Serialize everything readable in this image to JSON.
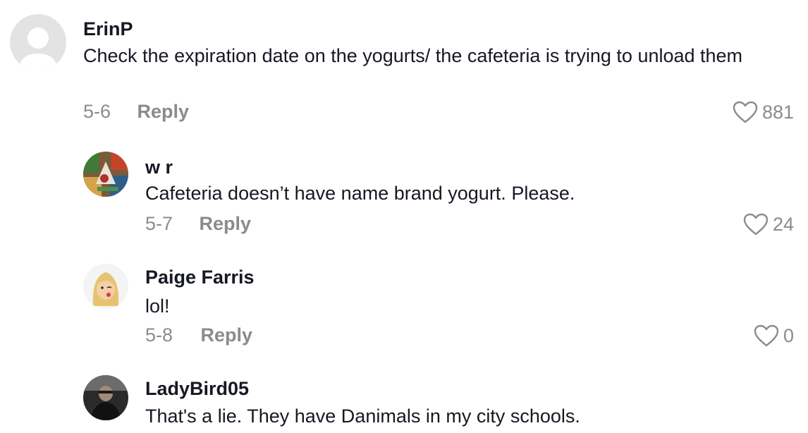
{
  "comments": [
    {
      "author": "ErinP",
      "text": "Check the expiration date on the yogurts/ the cafeteria is trying to unload them",
      "date": "5-6",
      "reply_label": "Reply",
      "likes": "881",
      "avatar": "default-avatar"
    },
    {
      "author": "w r",
      "text": "Cafeteria doesn’t have name brand yogurt. Please.",
      "date": "5-7",
      "reply_label": "Reply",
      "likes": "24",
      "avatar": "colorful-photo-avatar"
    },
    {
      "author": "Paige Farris",
      "text": "lol!",
      "date": "5-8",
      "reply_label": "Reply",
      "likes": "0",
      "avatar": "memoji-avatar"
    },
    {
      "author": "LadyBird05",
      "text": "That's a lie. They have Danimals in my city schools.",
      "avatar": "photo-avatar"
    }
  ],
  "colors": {
    "text": "#161823",
    "muted": "#8a8b91",
    "avatar_default": "#e3e3e4"
  }
}
